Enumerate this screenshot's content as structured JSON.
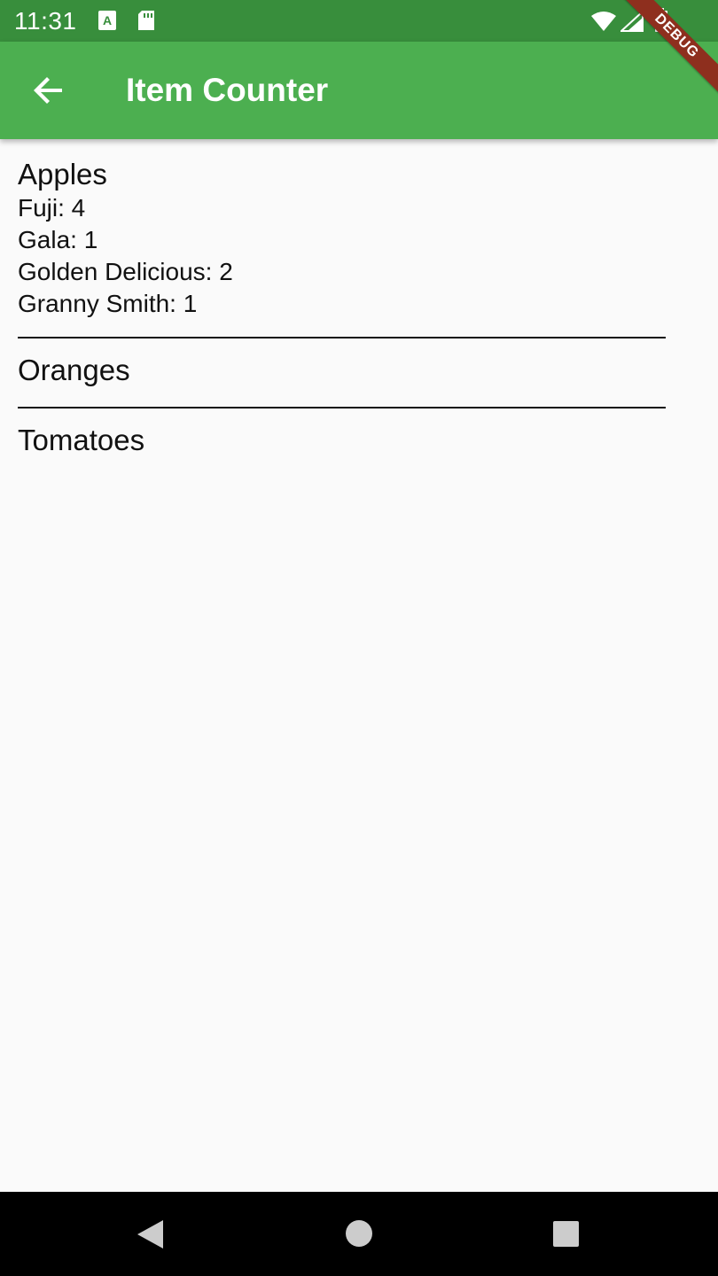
{
  "status_bar": {
    "time": "11:31",
    "icons": [
      "app-notification-icon",
      "sd-card-icon",
      "wifi-icon",
      "cell-signal-icon",
      "battery-icon"
    ]
  },
  "app_bar": {
    "title": "Item Counter",
    "back_icon": "arrow-back-icon",
    "color": "#4caf50",
    "status_color": "#388e3c"
  },
  "debug_banner": "DEBUG",
  "groups": [
    {
      "title": "Apples",
      "items": [
        "Fuji: 4",
        "Gala: 1",
        "Golden Delicious: 2",
        "Granny Smith: 1"
      ]
    },
    {
      "title": "Oranges",
      "items": []
    },
    {
      "title": "Tomatoes",
      "items": []
    }
  ],
  "nav_bar": {
    "buttons": [
      "back-triangle-icon",
      "home-circle-icon",
      "recents-square-icon"
    ]
  }
}
